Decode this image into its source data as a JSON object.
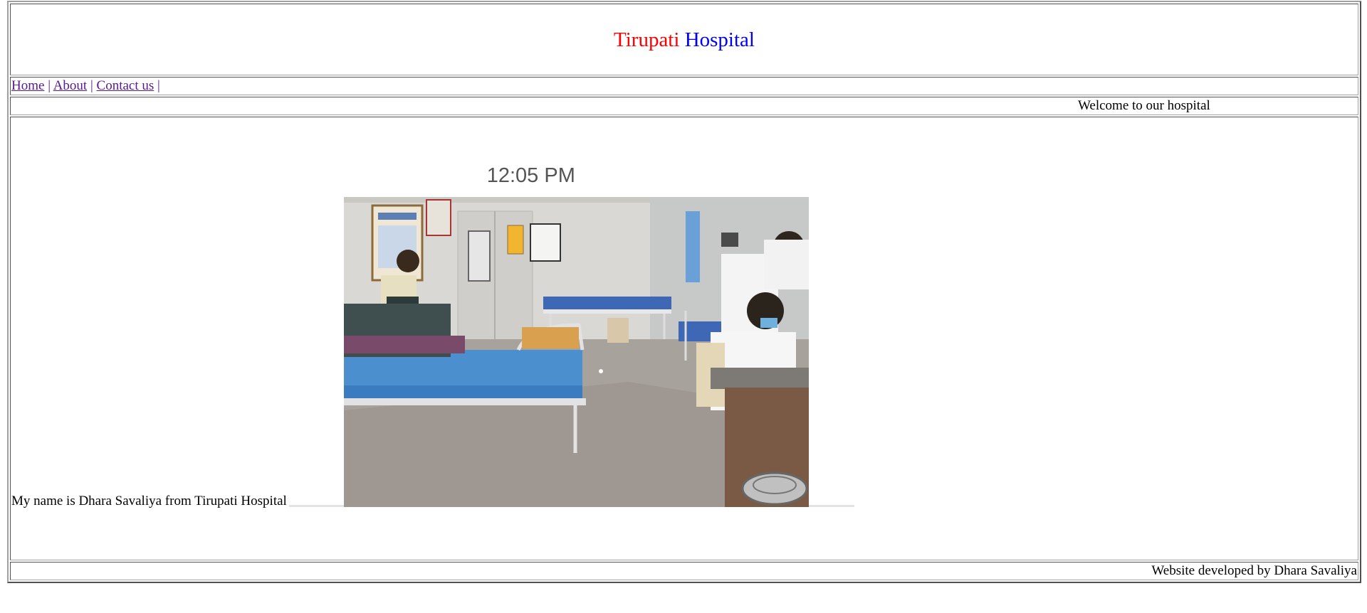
{
  "header": {
    "title_part1": "Tirupati",
    "title_part2": "Hospital"
  },
  "nav": {
    "items": [
      {
        "label": "Home"
      },
      {
        "label": "About"
      },
      {
        "label": "Contact us"
      }
    ],
    "separator": "|"
  },
  "marquee": {
    "text": "Welcome to our hospital"
  },
  "content": {
    "intro": "My name is Dhara Savaliya from Tirupati Hospital",
    "time_label": "12:05 PM",
    "image_alt": "Hospital ward with patient beds and doctors"
  },
  "footer": {
    "text": "Website developed by Dhara Savaliya"
  },
  "colors": {
    "title_red": "#ff0000",
    "title_blue": "#0000ff",
    "link": "#551a8b"
  }
}
